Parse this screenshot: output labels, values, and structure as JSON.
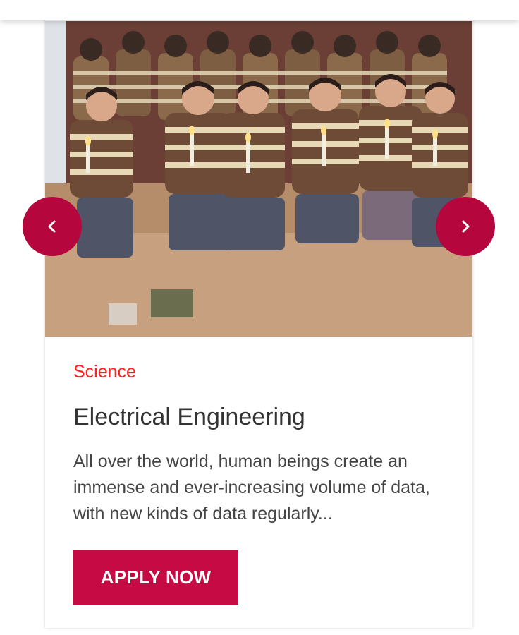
{
  "course": {
    "category": "Science",
    "title": "Electrical Engineering",
    "description": "All over the world, human beings create an immense and ever-increasing volume of data, with new kinds of data regularly...",
    "button_label": "APPLY NOW"
  },
  "carousel": {
    "prev_icon": "chevron-left-icon",
    "next_icon": "chevron-right-icon"
  },
  "colors": {
    "accent": "#c50a44",
    "arrow": "#b5073d",
    "category": "#ff1f1f",
    "title": "#333333",
    "text": "#444444"
  }
}
